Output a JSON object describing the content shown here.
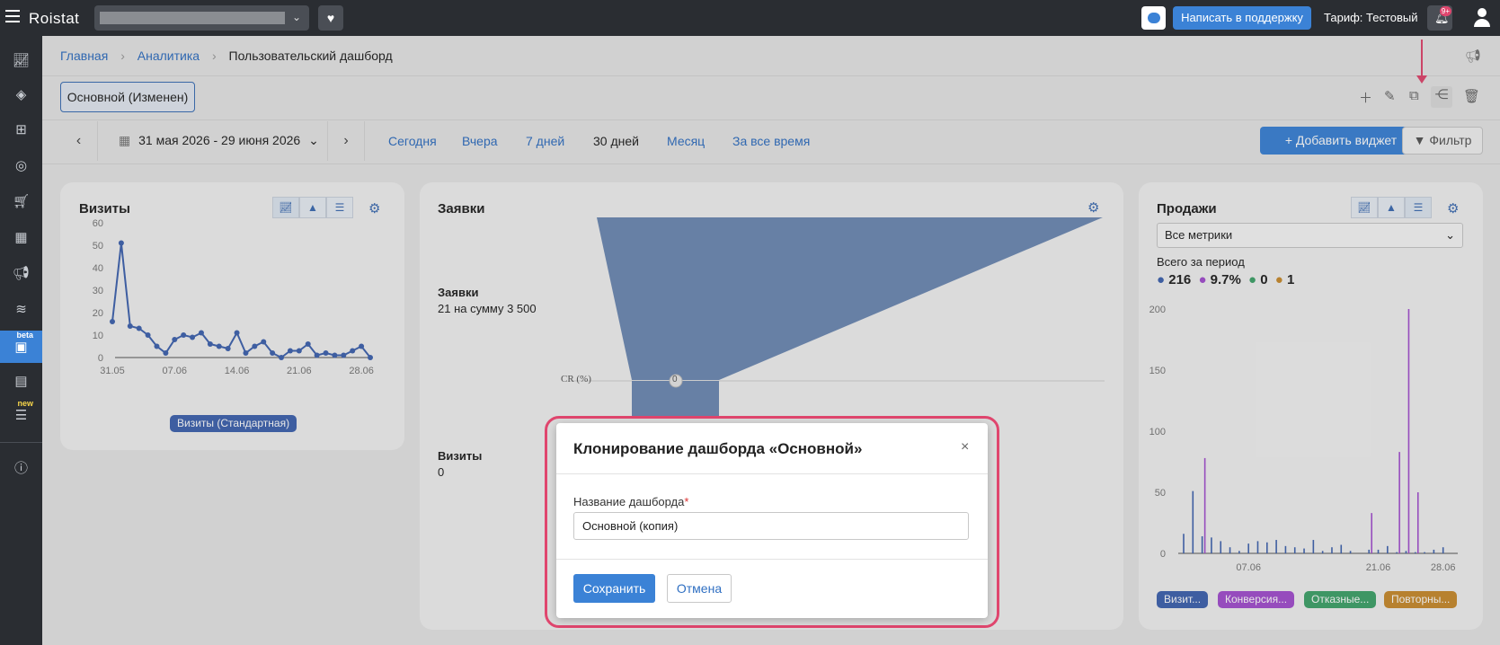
{
  "topbar": {
    "logo": "Roistat",
    "project_placeholder": "",
    "support_label": "Написать в поддержку",
    "tariff_label": "Тариф: Тестовый",
    "notif_badge": "9+"
  },
  "sidebar": {
    "items": [
      {
        "icon": "analytics-icon"
      },
      {
        "icon": "layers-plus-icon"
      },
      {
        "icon": "sitemap-icon"
      },
      {
        "icon": "money-icon"
      },
      {
        "icon": "cart-icon"
      },
      {
        "icon": "calendar-icon"
      },
      {
        "icon": "megaphone-icon"
      },
      {
        "icon": "layers-icon"
      },
      {
        "icon": "dashboard-icon",
        "badge": "beta"
      },
      {
        "icon": "chat-icon"
      },
      {
        "icon": "list-icon",
        "badge": "new"
      },
      {
        "icon": "info-icon"
      }
    ]
  },
  "breadcrumb": {
    "home": "Главная",
    "analytics": "Аналитика",
    "current": "Пользовательский дашборд"
  },
  "dashboard_tab": "Основной (Изменен)",
  "datebar": {
    "range": "31 мая 2026 - 29 июня 2026",
    "today": "Сегодня",
    "yesterday": "Вчера",
    "days7": "7 дней",
    "days30": "30 дней",
    "month": "Месяц",
    "all_time": "За все время",
    "add_widget": "+ Добавить виджет",
    "filter": "Фильтр"
  },
  "visits_card": {
    "title": "Визиты",
    "y_ticks": [
      "60",
      "50",
      "40",
      "30",
      "20",
      "10",
      "0"
    ],
    "x_ticks": [
      "31.05",
      "07.06",
      "14.06",
      "21.06",
      "28.06"
    ],
    "legend": "Визиты (Стандартная)"
  },
  "requests_card": {
    "title": "Заявки",
    "stage1_title": "Заявки",
    "stage1_value": "21 на сумму 3 500",
    "cr_label": "CR (%)",
    "cr_value": "0",
    "stage2_title": "Визиты",
    "stage2_value": "0"
  },
  "sales_card": {
    "title": "Продажи",
    "select_value": "Все метрики",
    "period_label": "Всего за период",
    "totals": [
      "216",
      "9.7%",
      "0",
      "1"
    ],
    "y_ticks": [
      "200",
      "150",
      "100",
      "50",
      "0"
    ],
    "x_ticks": [
      "07.06",
      "21.06",
      "28.06"
    ],
    "legend": [
      "Визит...",
      "Конверсия...",
      "Отказные...",
      "Повторны..."
    ]
  },
  "colors": {
    "accent": "#3b82d6",
    "series_blue": "#3f63b0",
    "series_purple": "#a34fd0",
    "series_green": "#3fa36a",
    "series_orange": "#c98b2e",
    "highlight": "#e0466e"
  },
  "modal": {
    "title": "Клонирование дашборда «Основной»",
    "field_label": "Название дашборда",
    "field_value": "Основной (копия)",
    "save": "Сохранить",
    "cancel": "Отмена"
  },
  "chart_data": [
    {
      "type": "line",
      "title": "Визиты",
      "x": [
        "31.05",
        "01.06",
        "02.06",
        "03.06",
        "04.06",
        "05.06",
        "06.06",
        "07.06",
        "08.06",
        "09.06",
        "10.06",
        "11.06",
        "12.06",
        "13.06",
        "14.06",
        "15.06",
        "16.06",
        "17.06",
        "18.06",
        "19.06",
        "20.06",
        "21.06",
        "22.06",
        "23.06",
        "24.06",
        "25.06",
        "26.06",
        "27.06",
        "28.06",
        "29.06"
      ],
      "series": [
        {
          "name": "Визиты (Стандартная)",
          "values": [
            16,
            51,
            14,
            13,
            10,
            5,
            2,
            8,
            10,
            9,
            11,
            6,
            5,
            4,
            11,
            2,
            5,
            7,
            2,
            0,
            3,
            3,
            6,
            1,
            2,
            1,
            1,
            3,
            5,
            0
          ]
        }
      ],
      "ylim": [
        0,
        60
      ]
    },
    {
      "type": "bar",
      "title": "Продажи",
      "series": [
        {
          "name": "Визит...",
          "values": [
            16,
            51,
            14,
            13,
            10,
            5,
            2,
            8,
            10,
            9,
            11,
            6,
            5,
            4,
            11,
            2,
            5,
            7,
            2,
            0,
            3,
            3,
            6,
            1,
            2,
            1,
            1,
            3,
            5,
            0
          ]
        },
        {
          "name": "Конверсия...",
          "values": [
            0,
            0,
            78,
            0,
            0,
            0,
            0,
            0,
            0,
            0,
            0,
            0,
            0,
            0,
            0,
            0,
            0,
            0,
            0,
            0,
            33,
            0,
            0,
            83,
            200,
            50,
            0,
            0,
            0,
            0
          ]
        }
      ],
      "ylim": [
        0,
        200
      ]
    }
  ]
}
